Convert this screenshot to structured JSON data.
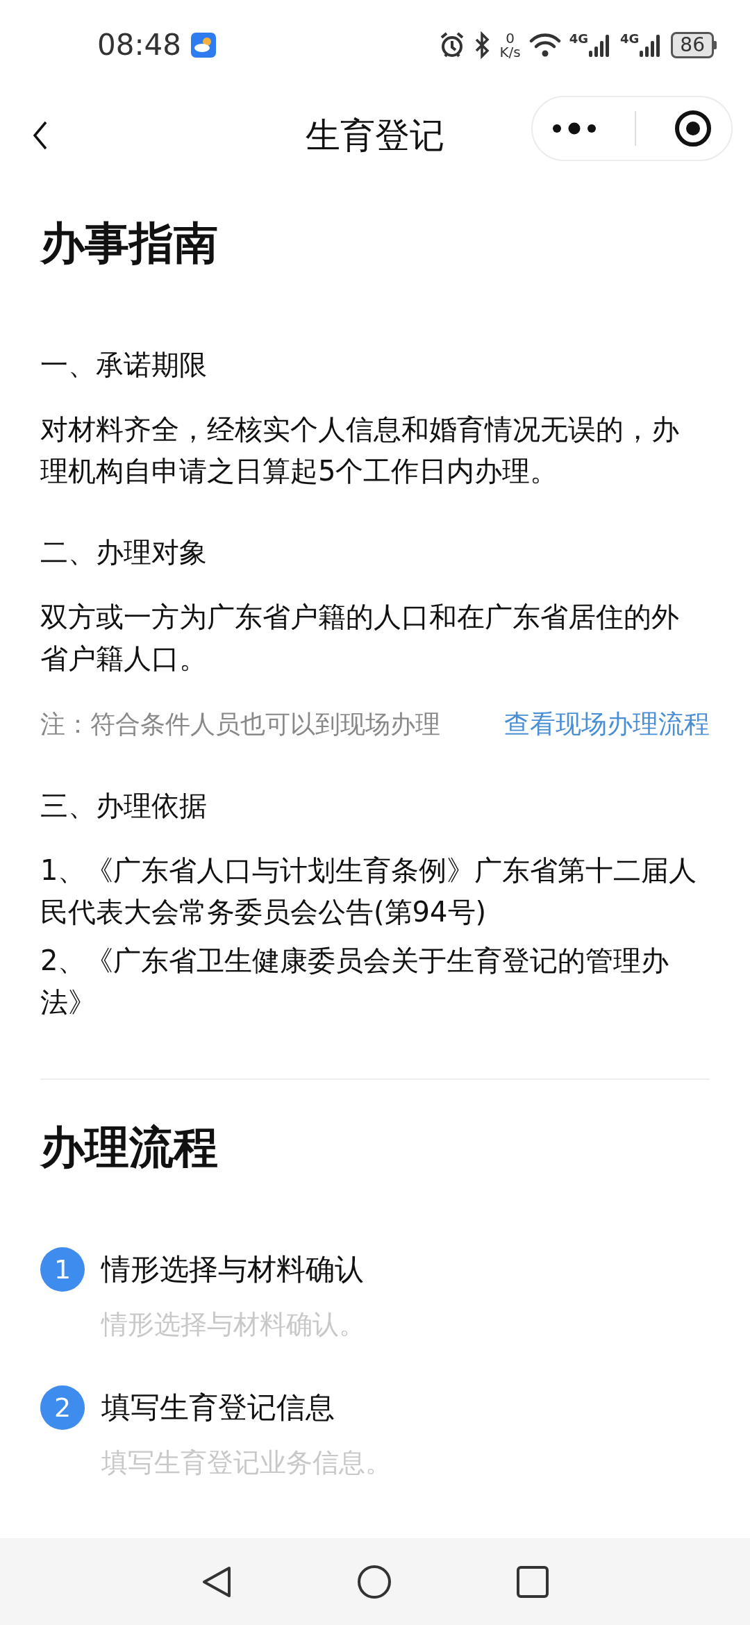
{
  "status_bar": {
    "time": "08:48",
    "speed_value": "0",
    "speed_unit": "K/s",
    "networks": [
      "4G",
      "4G"
    ],
    "battery": "86"
  },
  "header": {
    "title": "生育登记"
  },
  "guide": {
    "heading": "办事指南",
    "sections": [
      {
        "heading": "一、承诺期限",
        "paragraphs": [
          "对材料齐全，经核实个人信息和婚育情况无误的，办理机构自申请之日算起5个工作日内办理。"
        ]
      },
      {
        "heading": "二、办理对象",
        "paragraphs": [
          "双方或一方为广东省户籍的人口和在广东省居住的外省户籍人口。"
        ],
        "note": {
          "text": "注：符合条件人员也可以到现场办理",
          "link": "查看现场办理流程"
        }
      },
      {
        "heading": "三、办理依据",
        "paragraphs": [
          "1、《广东省人口与计划生育条例》广东省第十二届人民代表大会常务委员会公告(第94号)",
          "2、《广东省卫生健康委员会关于生育登记的管理办法》"
        ]
      }
    ]
  },
  "process": {
    "heading": "办理流程",
    "steps": [
      {
        "number": "1",
        "title": "情形选择与材料确认",
        "description": "情形选择与材料确认。"
      },
      {
        "number": "2",
        "title": "填写生育登记信息",
        "description": "填写生育登记业务信息。"
      }
    ]
  }
}
